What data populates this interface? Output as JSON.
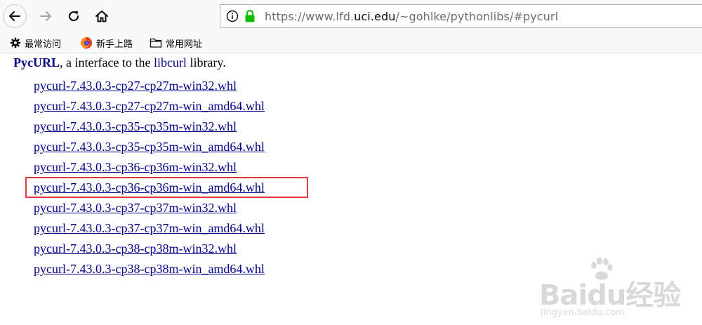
{
  "toolbar": {
    "url": {
      "prefix": "https://www.lfd.",
      "domain": "uci.edu",
      "path": "/~gohlke/pythonlibs/#pycurl"
    }
  },
  "bookmarks": [
    {
      "label": "最常访问",
      "icon": "gear-icon"
    },
    {
      "label": "新手上路",
      "icon": "firefox-icon"
    },
    {
      "label": "常用网址",
      "icon": "folder-icon"
    }
  ],
  "content": {
    "package_name": "PycURL",
    "intro_mid": ", a interface to the ",
    "lib_name": "libcurl",
    "intro_end": " library.",
    "files": [
      "pycurl-7.43.0.3-cp27-cp27m-win32.whl",
      "pycurl-7.43.0.3-cp27-cp27m-win_amd64.whl",
      "pycurl-7.43.0.3-cp35-cp35m-win32.whl",
      "pycurl-7.43.0.3-cp35-cp35m-win_amd64.whl",
      "pycurl-7.43.0.3-cp36-cp36m-win32.whl",
      "pycurl-7.43.0.3-cp36-cp36m-win_amd64.whl",
      "pycurl-7.43.0.3-cp37-cp37m-win32.whl",
      "pycurl-7.43.0.3-cp37-cp37m-win_amd64.whl",
      "pycurl-7.43.0.3-cp38-cp38m-win32.whl",
      "pycurl-7.43.0.3-cp38-cp38m-win_amd64.whl"
    ]
  },
  "watermark": {
    "logo": "Baidu经验",
    "url": "jingyan.baidu.com"
  },
  "colors": {
    "link": "#00008b",
    "highlight": "#e0393b",
    "lock": "#12bc00"
  }
}
